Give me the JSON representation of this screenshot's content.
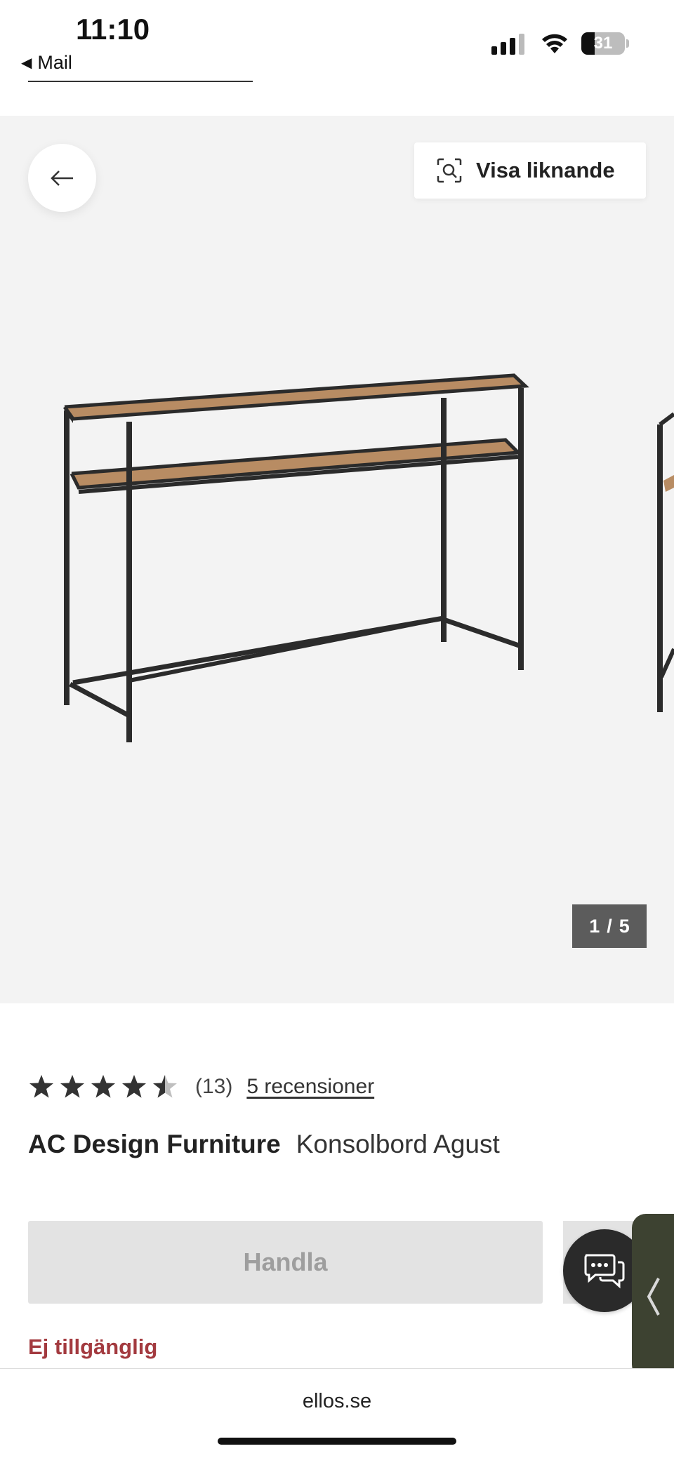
{
  "status_bar": {
    "time": "11:10",
    "back_app": "Mail",
    "battery_percent": "31",
    "battery_level": 0.31
  },
  "gallery": {
    "similar_button_label": "Visa liknande",
    "counter_current": "1",
    "counter_separator": "/",
    "counter_total": "5"
  },
  "product": {
    "rating": 4.5,
    "rating_max": 5,
    "review_count": "(13)",
    "reviews_link": "5 recensioner",
    "brand": "AC Design Furniture",
    "name": "Konsolbord Agust",
    "buy_label": "Handla",
    "availability": "Ej tillgänglig"
  },
  "browser": {
    "url": "ellos.se"
  },
  "colors": {
    "unavailable": "#a33a3f",
    "buy_disabled_bg": "#e3e3e3",
    "side_tab": "#3d4231"
  },
  "icons": {
    "back": "arrow-left-icon",
    "similar": "visual-search-icon",
    "star": "star-icon",
    "chat": "chat-bubbles-icon",
    "side_tab": "chevron-left-icon"
  }
}
